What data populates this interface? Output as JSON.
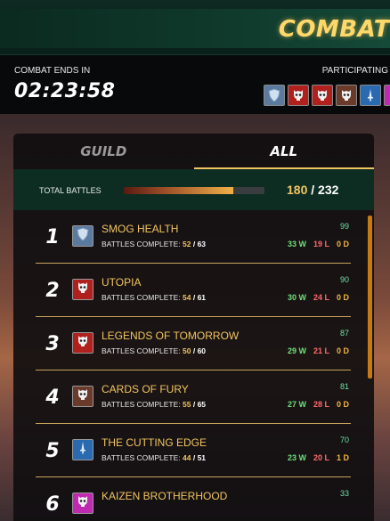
{
  "banner": {
    "title": "COMBAT"
  },
  "header": {
    "ends_label": "COMBAT ENDS IN",
    "timer": "02:23:58",
    "participating_label": "PARTICIPATING"
  },
  "participants": [
    {
      "icon": "shield-icon",
      "color": "#5a7aa0"
    },
    {
      "icon": "skull-icon",
      "color": "#b0201c"
    },
    {
      "icon": "skull-icon",
      "color": "#b0201c"
    },
    {
      "icon": "skull-icon",
      "color": "#6a3a2a"
    },
    {
      "icon": "sword-icon",
      "color": "#2a6ab0"
    },
    {
      "icon": "skull-icon",
      "color": "#c02ab0"
    }
  ],
  "tabs": [
    {
      "label": "GUILD",
      "active": false
    },
    {
      "label": "ALL",
      "active": true
    }
  ],
  "total": {
    "label": "TOTAL BATTLES",
    "done": "180",
    "sep": " / ",
    "all": "232",
    "progress": 0.7759
  },
  "guilds": [
    {
      "rank": "1",
      "name": "SMOG HEALTH",
      "bc_label": "BATTLES COMPLETE:",
      "done": "52",
      "total": "63",
      "score": "99",
      "w": "33 W",
      "l": "19 L",
      "d": "0 D",
      "icon": "shield-icon",
      "color": "#5a7aa0"
    },
    {
      "rank": "2",
      "name": "UTOPIA",
      "bc_label": "BATTLES COMPLETE:",
      "done": "54",
      "total": "61",
      "score": "90",
      "w": "30 W",
      "l": "24 L",
      "d": "0 D",
      "icon": "skull-icon",
      "color": "#b0201c"
    },
    {
      "rank": "3",
      "name": "LEGENDS OF TOMORROW",
      "bc_label": "BATTLES COMPLETE:",
      "done": "50",
      "total": "60",
      "score": "87",
      "w": "29 W",
      "l": "21 L",
      "d": "0 D",
      "icon": "skull-icon",
      "color": "#b0201c"
    },
    {
      "rank": "4",
      "name": "CARDS OF FURY",
      "bc_label": "BATTLES COMPLETE:",
      "done": "55",
      "total": "65",
      "score": "81",
      "w": "27 W",
      "l": "28 L",
      "d": "0 D",
      "icon": "skull-icon",
      "color": "#6a3a2a"
    },
    {
      "rank": "5",
      "name": "THE CUTTING EDGE",
      "bc_label": "BATTLES COMPLETE:",
      "done": "44",
      "total": "51",
      "score": "70",
      "w": "23 W",
      "l": "20 L",
      "d": "1 D",
      "icon": "sword-icon",
      "color": "#2a6ab0"
    },
    {
      "rank": "6",
      "name": "KAIZEN BROTHERHOOD",
      "bc_label": "",
      "done": "",
      "total": "",
      "score": "33",
      "w": "",
      "l": "",
      "d": "",
      "icon": "skull-icon",
      "color": "#c02ab0"
    }
  ]
}
